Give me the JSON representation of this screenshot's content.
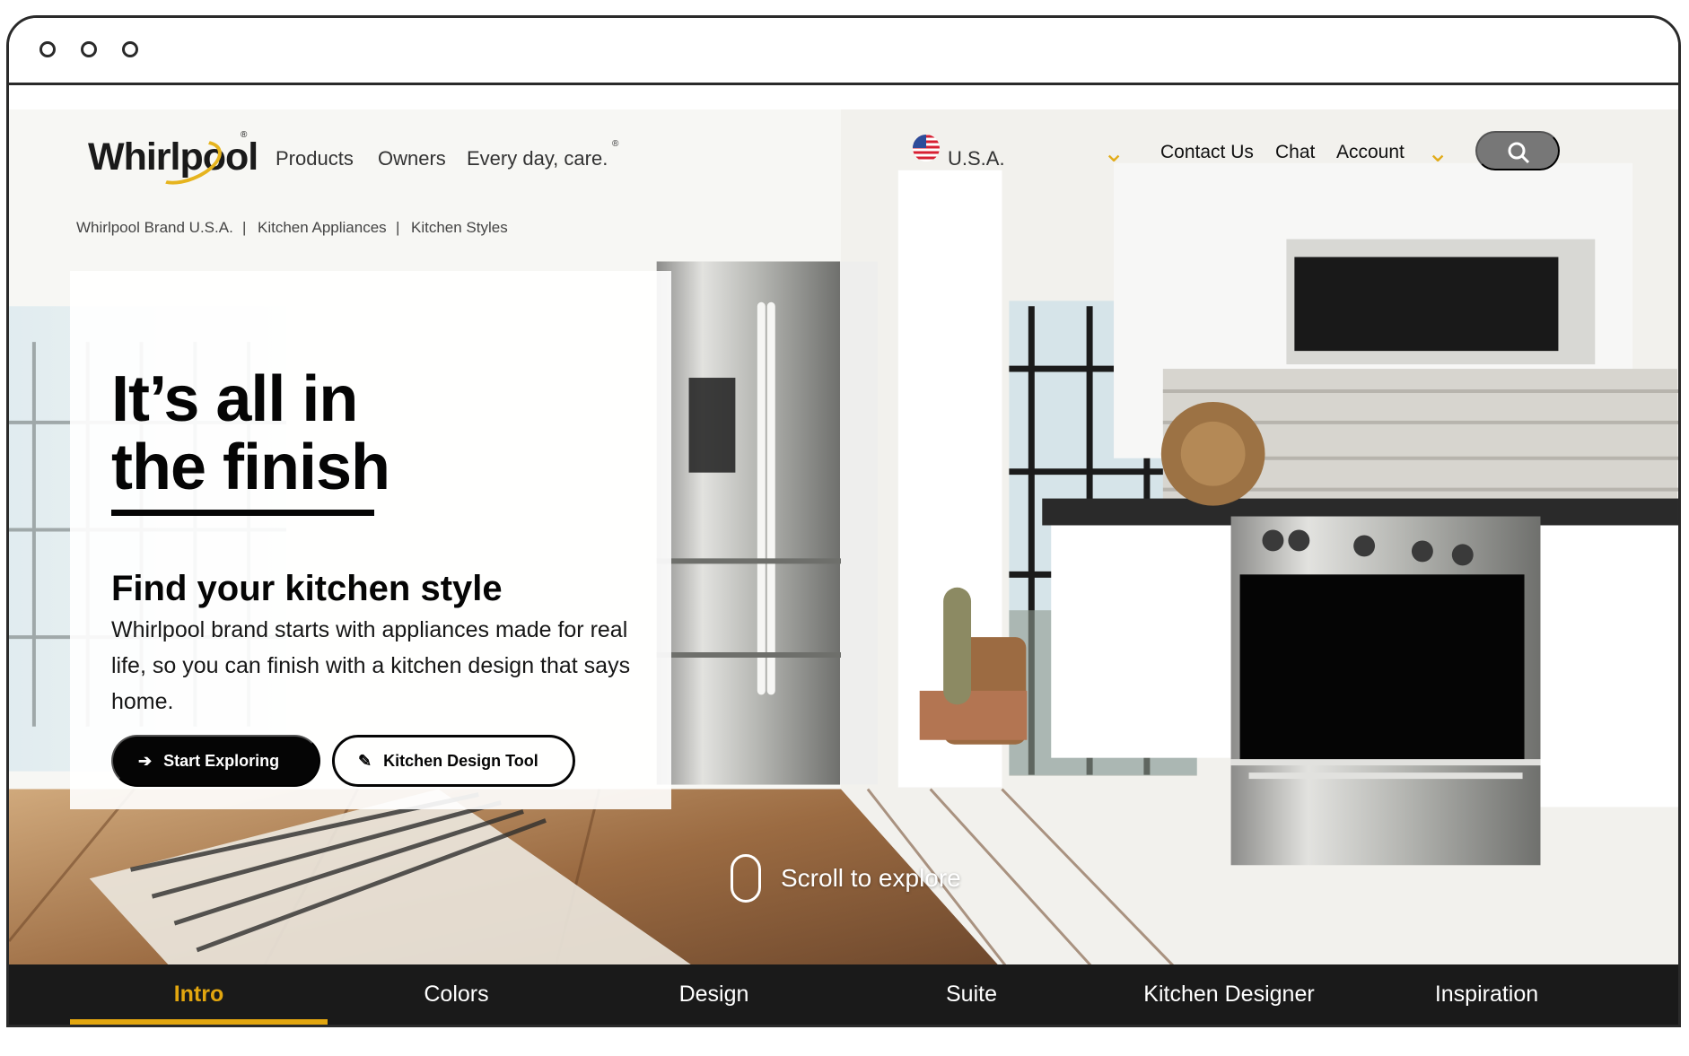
{
  "colors": {
    "accent": "#e2a60f",
    "navigation_background": "#1a1a1a",
    "text": "#050505"
  },
  "brand": {
    "logo": "Whirlpool",
    "registered_mark": "®"
  },
  "header": {
    "nav": [
      "Products",
      "Owners",
      "Every day, care."
    ],
    "region": "U.S.A.",
    "utility_links": [
      "Contact Us",
      "Chat",
      "Account"
    ],
    "search_icon": "search-icon"
  },
  "breadcrumb": [
    "Whirlpool Brand U.S.A.",
    "Kitchen Appliances",
    "Kitchen Styles"
  ],
  "hero": {
    "title_line1": "It’s all in",
    "title_line2": "the finish",
    "subtitle": "Find your kitchen style",
    "description": "Whirlpool brand starts with appliances made for real life, so you can finish with a kitchen design that says home.",
    "primary_button": "Start Exploring",
    "secondary_button": "Kitchen Design Tool",
    "scroll_hint": "Scroll to explore"
  },
  "section_nav": [
    "Intro",
    "Colors",
    "Design",
    "Suite",
    "Kitchen Designer",
    "Inspiration"
  ]
}
